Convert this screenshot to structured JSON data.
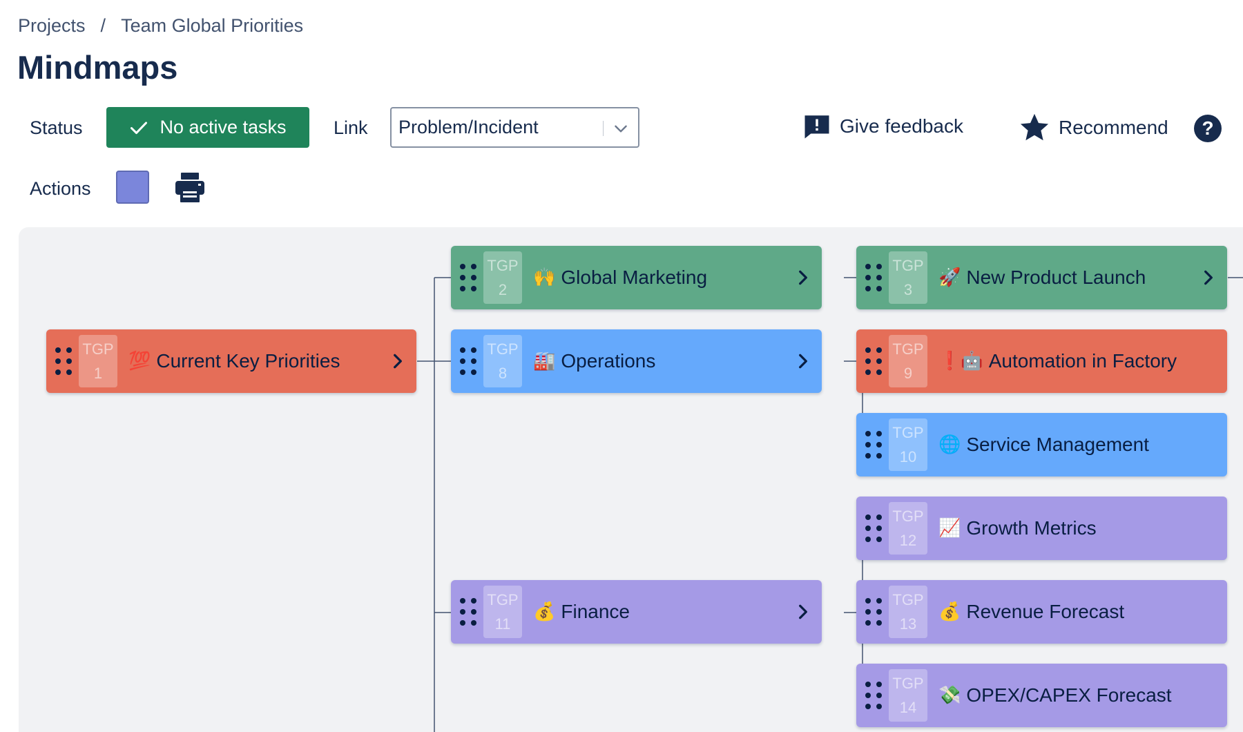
{
  "breadcrumb": {
    "projects": "Projects",
    "separator": "/",
    "current": "Team Global Priorities"
  },
  "page": {
    "title": "Mindmaps"
  },
  "toolbar": {
    "status_label": "Status",
    "status_value": "No active tasks",
    "link_label": "Link",
    "link_value": "Problem/Incident",
    "feedback_label": "Give feedback",
    "recommend_label": "Recommend",
    "help_glyph": "?",
    "actions_label": "Actions"
  },
  "colors": {
    "status_green": "#1f845a",
    "node_red": "#e56e58",
    "node_green": "#5fa988",
    "node_blue": "#65a9fc",
    "node_purple": "#a59ae6",
    "swatch": "#7b86db"
  },
  "icons": [
    "check-icon",
    "chevron-down-icon",
    "feedback-icon",
    "star-icon",
    "help-icon",
    "printer-icon",
    "drag-handle-icon",
    "chevron-right-icon"
  ],
  "nodes": {
    "n1": {
      "key": "TGP",
      "num": "1",
      "emoji": "💯",
      "title": "Current Key Priorities"
    },
    "n2": {
      "key": "TGP",
      "num": "2",
      "emoji": "🙌",
      "title": "Global Marketing"
    },
    "n3": {
      "key": "TGP",
      "num": "3",
      "emoji": "🚀",
      "title": "New Product Launch"
    },
    "n8": {
      "key": "TGP",
      "num": "8",
      "emoji": "🏭",
      "title": "Operations"
    },
    "n9": {
      "key": "TGP",
      "num": "9",
      "emoji": "❗🤖",
      "title": "Automation in Factory"
    },
    "n10": {
      "key": "TGP",
      "num": "10",
      "emoji": "🌐",
      "title": "Service Management"
    },
    "n11": {
      "key": "TGP",
      "num": "11",
      "emoji": "💰",
      "title": "Finance"
    },
    "n12": {
      "key": "TGP",
      "num": "12",
      "emoji": "📈",
      "title": "Growth Metrics"
    },
    "n13": {
      "key": "TGP",
      "num": "13",
      "emoji": "💰",
      "title": "Revenue Forecast"
    },
    "n14": {
      "key": "TGP",
      "num": "14",
      "emoji": "💸",
      "title": "OPEX/CAPEX Forecast"
    }
  }
}
